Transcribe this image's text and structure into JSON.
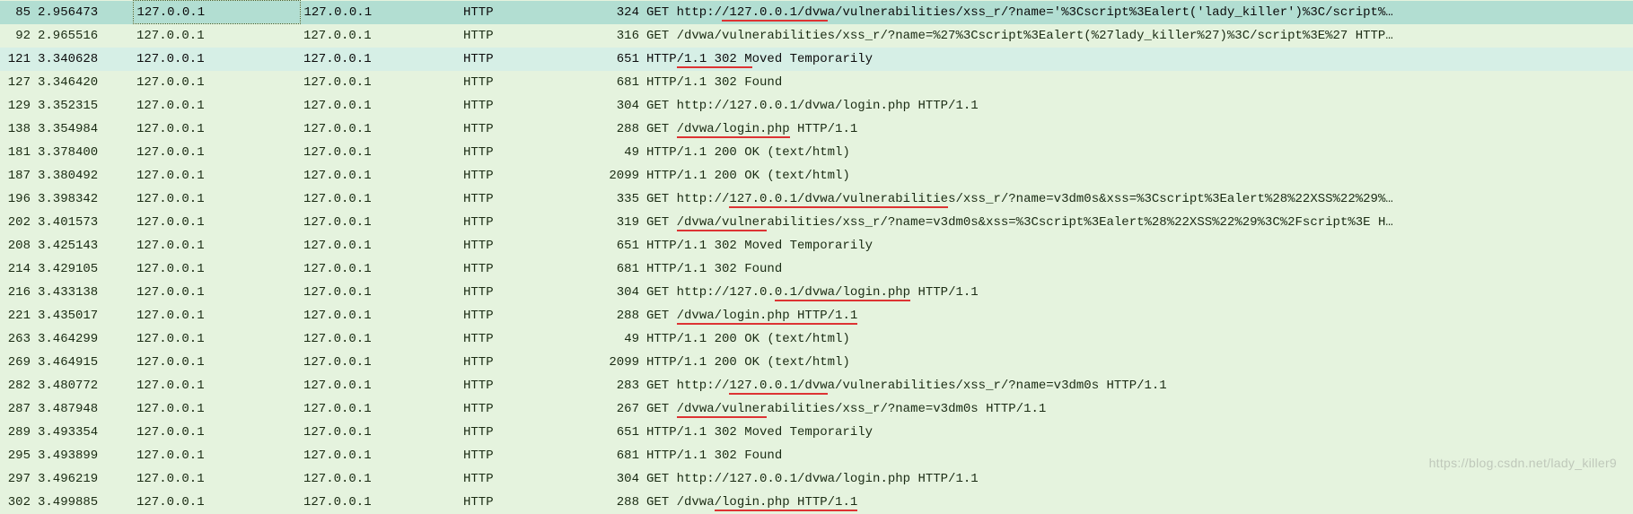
{
  "watermark": "https://blog.csdn.net/lady_killer9",
  "rows": [
    {
      "no": "85",
      "time": "2.956473",
      "src": "127.0.0.1",
      "dst": "127.0.0.1",
      "proto": "HTTP",
      "len": "324",
      "info": "GET http://127.0.0.1/dvwa/vulnerabilities/xss_r/?name='%3Cscript%3Ealert('lady_killer')%3C/script%…",
      "cls": "row-selected",
      "boxedSrc": true,
      "ul": [
        [
          10,
          24
        ]
      ]
    },
    {
      "no": "92",
      "time": "2.965516",
      "src": "127.0.0.1",
      "dst": "127.0.0.1",
      "proto": "HTTP",
      "len": "316",
      "info": "GET /dvwa/vulnerabilities/xss_r/?name=%27%3Cscript%3Ealert(%27lady_killer%27)%3C/script%3E%27 HTTP…",
      "cls": "row-normal"
    },
    {
      "no": "121",
      "time": "3.340628",
      "src": "127.0.0.1",
      "dst": "127.0.0.1",
      "proto": "HTTP",
      "len": "651",
      "info": "HTTP/1.1 302 Moved Temporarily",
      "cls": "row-highlight",
      "ul": [
        [
          4,
          14
        ]
      ]
    },
    {
      "no": "127",
      "time": "3.346420",
      "src": "127.0.0.1",
      "dst": "127.0.0.1",
      "proto": "HTTP",
      "len": "681",
      "info": "HTTP/1.1 302 Found",
      "cls": "row-normal"
    },
    {
      "no": "129",
      "time": "3.352315",
      "src": "127.0.0.1",
      "dst": "127.0.0.1",
      "proto": "HTTP",
      "len": "304",
      "info": "GET http://127.0.0.1/dvwa/login.php HTTP/1.1",
      "cls": "row-normal"
    },
    {
      "no": "138",
      "time": "3.354984",
      "src": "127.0.0.1",
      "dst": "127.0.0.1",
      "proto": "HTTP",
      "len": "288",
      "info": "GET /dvwa/login.php HTTP/1.1",
      "cls": "row-normal",
      "ul": [
        [
          4,
          19
        ]
      ]
    },
    {
      "no": "181",
      "time": "3.378400",
      "src": "127.0.0.1",
      "dst": "127.0.0.1",
      "proto": "HTTP",
      "len": "49",
      "info": "HTTP/1.1 200 OK  (text/html)",
      "cls": "row-normal"
    },
    {
      "no": "187",
      "time": "3.380492",
      "src": "127.0.0.1",
      "dst": "127.0.0.1",
      "proto": "HTTP",
      "len": "2099",
      "info": "HTTP/1.1 200 OK  (text/html)",
      "cls": "row-normal"
    },
    {
      "no": "196",
      "time": "3.398342",
      "src": "127.0.0.1",
      "dst": "127.0.0.1",
      "proto": "HTTP",
      "len": "335",
      "info": "GET http://127.0.0.1/dvwa/vulnerabilities/xss_r/?name=v3dm0s&xss=%3Cscript%3Ealert%28%22XSS%22%29%…",
      "cls": "row-normal",
      "ul": [
        [
          11,
          40
        ]
      ]
    },
    {
      "no": "202",
      "time": "3.401573",
      "src": "127.0.0.1",
      "dst": "127.0.0.1",
      "proto": "HTTP",
      "len": "319",
      "info": "GET /dvwa/vulnerabilities/xss_r/?name=v3dm0s&xss=%3Cscript%3Ealert%28%22XSS%22%29%3C%2Fscript%3E H…",
      "cls": "row-normal",
      "ul": [
        [
          4,
          16
        ]
      ]
    },
    {
      "no": "208",
      "time": "3.425143",
      "src": "127.0.0.1",
      "dst": "127.0.0.1",
      "proto": "HTTP",
      "len": "651",
      "info": "HTTP/1.1 302 Moved Temporarily",
      "cls": "row-normal"
    },
    {
      "no": "214",
      "time": "3.429105",
      "src": "127.0.0.1",
      "dst": "127.0.0.1",
      "proto": "HTTP",
      "len": "681",
      "info": "HTTP/1.1 302 Found",
      "cls": "row-normal"
    },
    {
      "no": "216",
      "time": "3.433138",
      "src": "127.0.0.1",
      "dst": "127.0.0.1",
      "proto": "HTTP",
      "len": "304",
      "info": "GET http://127.0.0.1/dvwa/login.php HTTP/1.1",
      "cls": "row-normal",
      "ul": [
        [
          17,
          35
        ]
      ]
    },
    {
      "no": "221",
      "time": "3.435017",
      "src": "127.0.0.1",
      "dst": "127.0.0.1",
      "proto": "HTTP",
      "len": "288",
      "info": "GET /dvwa/login.php HTTP/1.1",
      "cls": "row-normal",
      "ul": [
        [
          4,
          28
        ]
      ]
    },
    {
      "no": "263",
      "time": "3.464299",
      "src": "127.0.0.1",
      "dst": "127.0.0.1",
      "proto": "HTTP",
      "len": "49",
      "info": "HTTP/1.1 200 OK  (text/html)",
      "cls": "row-normal"
    },
    {
      "no": "269",
      "time": "3.464915",
      "src": "127.0.0.1",
      "dst": "127.0.0.1",
      "proto": "HTTP",
      "len": "2099",
      "info": "HTTP/1.1 200 OK  (text/html)",
      "cls": "row-normal"
    },
    {
      "no": "282",
      "time": "3.480772",
      "src": "127.0.0.1",
      "dst": "127.0.0.1",
      "proto": "HTTP",
      "len": "283",
      "info": "GET http://127.0.0.1/dvwa/vulnerabilities/xss_r/?name=v3dm0s HTTP/1.1",
      "cls": "row-normal",
      "ul": [
        [
          11,
          24
        ]
      ]
    },
    {
      "no": "287",
      "time": "3.487948",
      "src": "127.0.0.1",
      "dst": "127.0.0.1",
      "proto": "HTTP",
      "len": "267",
      "info": "GET /dvwa/vulnerabilities/xss_r/?name=v3dm0s HTTP/1.1",
      "cls": "row-normal",
      "ul": [
        [
          4,
          16
        ]
      ]
    },
    {
      "no": "289",
      "time": "3.493354",
      "src": "127.0.0.1",
      "dst": "127.0.0.1",
      "proto": "HTTP",
      "len": "651",
      "info": "HTTP/1.1 302 Moved Temporarily",
      "cls": "row-normal"
    },
    {
      "no": "295",
      "time": "3.493899",
      "src": "127.0.0.1",
      "dst": "127.0.0.1",
      "proto": "HTTP",
      "len": "681",
      "info": "HTTP/1.1 302 Found",
      "cls": "row-normal"
    },
    {
      "no": "297",
      "time": "3.496219",
      "src": "127.0.0.1",
      "dst": "127.0.0.1",
      "proto": "HTTP",
      "len": "304",
      "info": "GET http://127.0.0.1/dvwa/login.php HTTP/1.1",
      "cls": "row-normal"
    },
    {
      "no": "302",
      "time": "3.499885",
      "src": "127.0.0.1",
      "dst": "127.0.0.1",
      "proto": "HTTP",
      "len": "288",
      "info": "GET /dvwa/login.php HTTP/1.1",
      "cls": "row-normal",
      "ul": [
        [
          9,
          28
        ]
      ]
    }
  ]
}
